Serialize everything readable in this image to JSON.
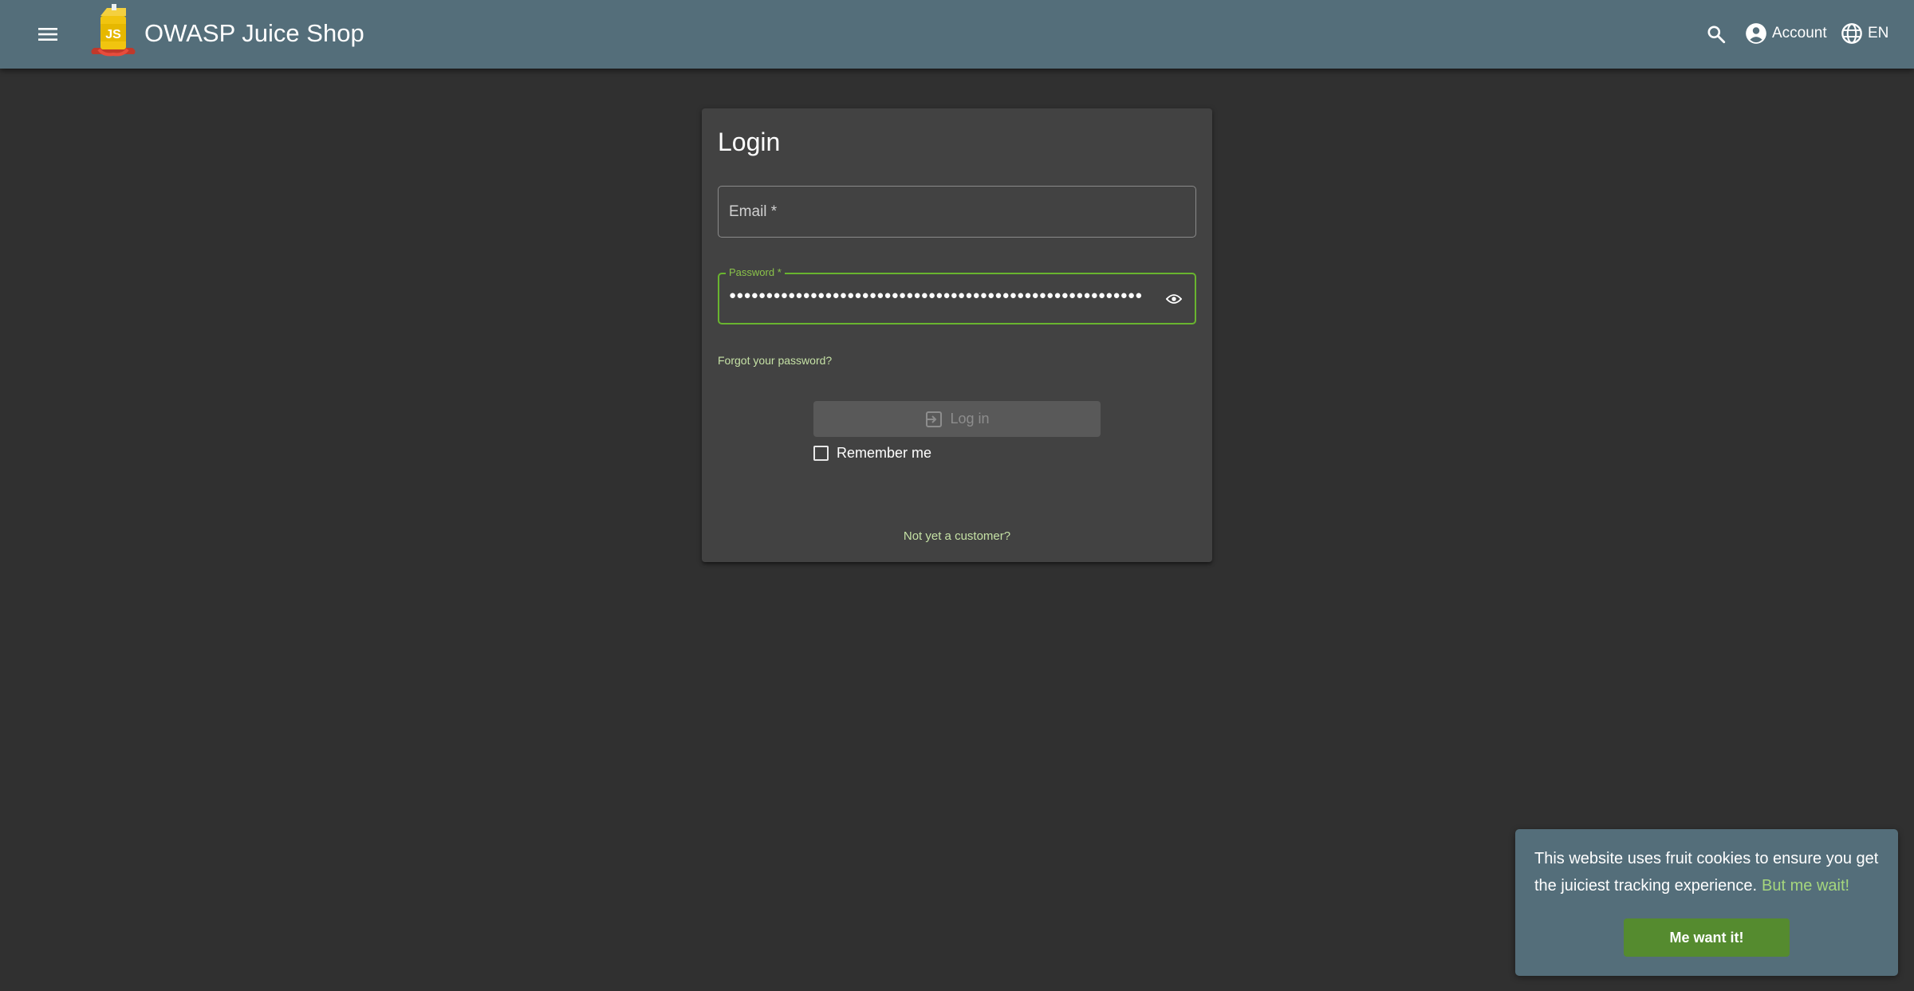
{
  "header": {
    "title": "OWASP Juice Shop",
    "menu_icon": "menu-icon",
    "logo": "juice-shop-logo",
    "search_icon": "search-icon",
    "account_label": "Account",
    "account_icon": "account-circle-icon",
    "language_label": "EN",
    "language_icon": "globe-icon"
  },
  "login": {
    "title": "Login",
    "email_label": "Email *",
    "email_value": "",
    "password_label": "Password *",
    "password_value": "●●●●●●●●●●●●●●●●●●●●●●●●●●●●●●●●●●●●●●●●●●●●●●●●●●●●●●●●",
    "password_visibility_icon": "eye-icon",
    "forgot_password": "Forgot your password?",
    "login_button": "Log in",
    "login_icon": "login-icon",
    "remember_me": "Remember me",
    "remember_me_checked": false,
    "register_link": "Not yet a customer?"
  },
  "cookie_banner": {
    "message": "This website uses fruit cookies to ensure you get the juiciest tracking experience.",
    "link": "But me wait!",
    "button": "Me want it!"
  },
  "colors": {
    "toolbar": "#546e7a",
    "background": "#303030",
    "card": "#424242",
    "accent": "#8bc34a",
    "link": "#c5e1a5",
    "cookie_button": "#558b2f"
  }
}
